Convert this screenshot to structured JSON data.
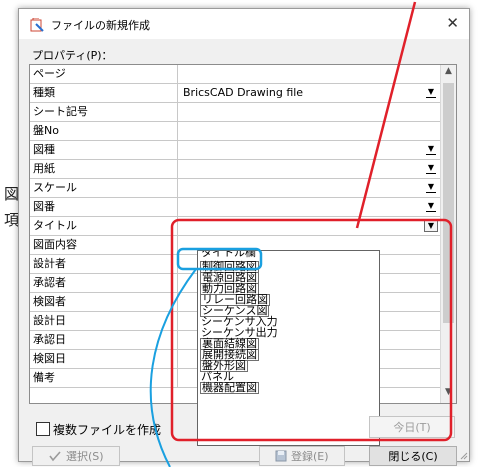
{
  "side_chars": [
    "図",
    "項"
  ],
  "window": {
    "title": "ファイルの新規作成",
    "close_glyph": "✕"
  },
  "properties_label": "プロパティ(P)：",
  "rows": [
    {
      "name": "ページ",
      "value": ""
    },
    {
      "name": "種類",
      "value": "BricsCAD Drawing file"
    },
    {
      "name": "シート記号",
      "value": ""
    },
    {
      "name": "盤No",
      "value": ""
    },
    {
      "name": "図種",
      "value": ""
    },
    {
      "name": "用紙",
      "value": ""
    },
    {
      "name": "スケール",
      "value": ""
    },
    {
      "name": "図番",
      "value": ""
    },
    {
      "name": "タイトル",
      "value": ""
    },
    {
      "name": "図面内容",
      "value": ""
    },
    {
      "name": "設計者",
      "value": ""
    },
    {
      "name": "承認者",
      "value": ""
    },
    {
      "name": "検図者",
      "value": ""
    },
    {
      "name": "設計日",
      "value": ""
    },
    {
      "name": "承認日",
      "value": ""
    },
    {
      "name": "検図日",
      "value": ""
    },
    {
      "name": "備考",
      "value": ""
    }
  ],
  "dropdown_options": [
    "タイトル欄",
    "制御回路図",
    "電源回路図",
    "動力回路図",
    "リレー回路図",
    "シーケンス図",
    "シーケンサ入力",
    "シーケンサ出力",
    "裏面結線図",
    "展開接続図",
    "盤外形図",
    "パネル",
    "機器配置図"
  ],
  "dropdown_selected": "制御回路図",
  "footer": {
    "multi_file_label": "複数ファイルを作成",
    "today_button": "今日(T)",
    "select_button": "選択(S)",
    "register_button": "登録(E)",
    "close_button": "閉じる(C)"
  },
  "colors": {
    "annotation_red": "#e0202a",
    "annotation_blue": "#1aa0e0"
  },
  "icons": [
    "app-icon",
    "close-icon",
    "dropdown-arrow-icon",
    "scroll-up-icon",
    "scroll-down-icon",
    "check-icon",
    "save-icon",
    "size-grip-icon"
  ]
}
